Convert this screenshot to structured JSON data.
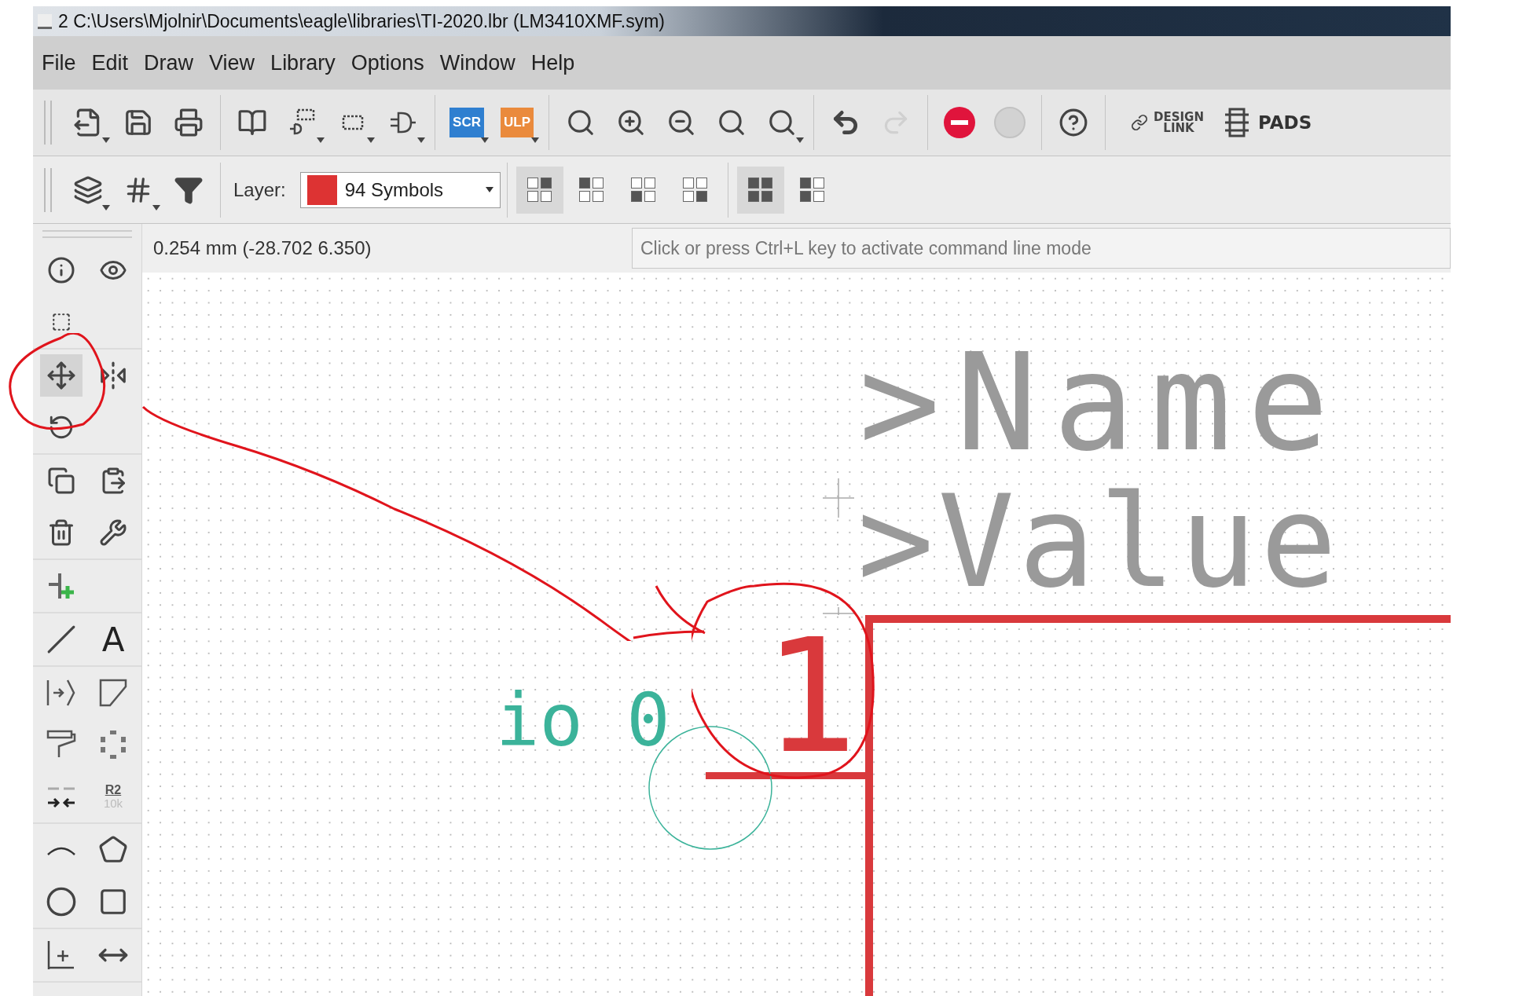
{
  "window": {
    "title": "2 C:\\Users\\Mjolnir\\Documents\\eagle\\libraries\\TI-2020.lbr (LM3410XMF.sym)"
  },
  "menu": [
    "File",
    "Edit",
    "Draw",
    "View",
    "Library",
    "Options",
    "Window",
    "Help"
  ],
  "toolbar": {
    "scr": "SCR",
    "ulp": "ULP",
    "redo": {
      "disabled": true
    },
    "go": {
      "disabled": true
    },
    "design_link": "DESIGN LINK",
    "pads": "PADS"
  },
  "layer_bar": {
    "label": "Layer:",
    "layer": {
      "value": "94 Symbols",
      "color": "#dd3333"
    },
    "views": [
      {
        "selected": true
      },
      {
        "selected": false
      },
      {
        "selected": false
      },
      {
        "selected": false
      },
      {
        "selected": true
      },
      {
        "selected": false
      }
    ]
  },
  "coordinates": "0.254 mm (-28.702 6.350)",
  "command_line": {
    "placeholder": "Click or press Ctrl+L key to activate command line mode"
  },
  "tools": [
    [
      {
        "selected": false
      },
      {
        "selected": false
      },
      {
        "selected": false
      }
    ],
    [
      {
        "selected": true
      },
      {
        "selected": false
      },
      {
        "selected": false
      }
    ],
    [
      {
        "selected": false
      },
      {
        "selected": false
      },
      {
        "selected": false
      },
      {
        "selected": false
      }
    ],
    [
      {
        "selected": false
      }
    ],
    [
      {
        "selected": false
      },
      {
        "selected": false,
        "glyph": "A"
      }
    ],
    [
      {
        "selected": false
      },
      {
        "selected": false
      },
      {
        "selected": false
      },
      {
        "selected": false
      },
      {
        "selected": false
      },
      {
        "selected": false,
        "label": "R2",
        "sublabel": "10k"
      }
    ],
    [
      {
        "selected": false
      },
      {
        "selected": false
      },
      {
        "selected": false
      },
      {
        "selected": false
      }
    ],
    [
      {
        "selected": false
      },
      {
        "selected": false
      }
    ]
  ],
  "canvas": {
    "name_label": ">Name",
    "value_label": ">Value",
    "pin_number": "1",
    "pin_name": "io 0"
  }
}
